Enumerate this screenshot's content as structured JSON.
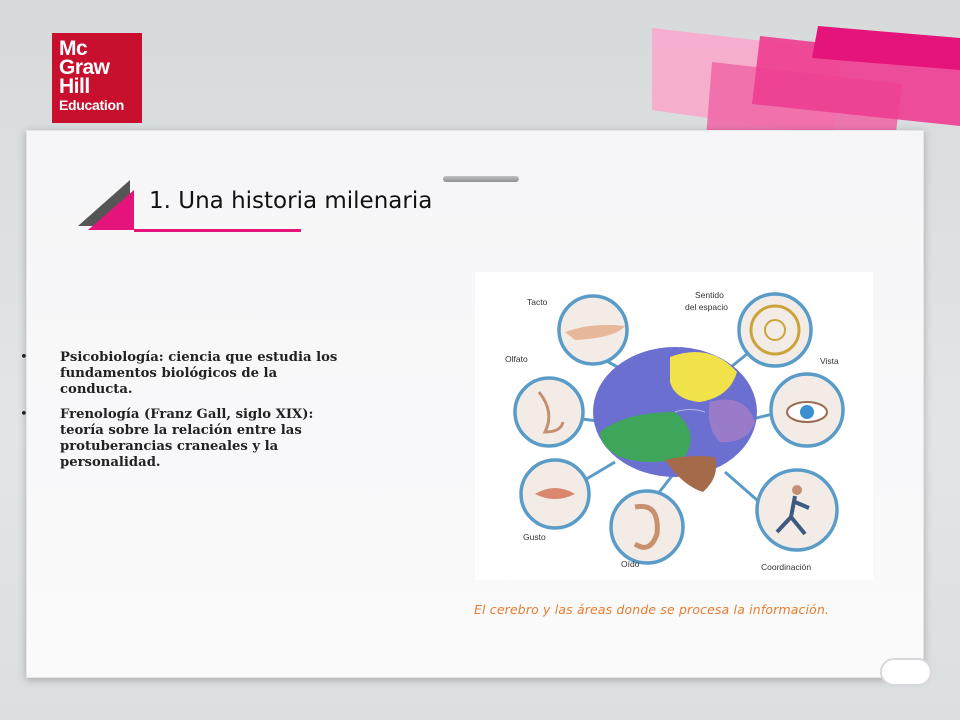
{
  "logo": {
    "line1": "Mc",
    "line2": "Graw",
    "line3": "Hill",
    "line4": "Education"
  },
  "slide": {
    "title": "1. Una historia milenaria",
    "bullets": [
      {
        "marker": "•",
        "text": "Psicobiología: ciencia que estudia los fundamentos biológicos de la conducta."
      },
      {
        "marker": "•",
        "text": "Frenología (Franz Gall, siglo XIX): teoría sobre la relación entre las protuberancias craneales y la personalidad."
      }
    ]
  },
  "figure": {
    "labels": {
      "tacto": "Tacto",
      "sentido1": "Sentido",
      "sentido2": "del espacio",
      "olfato": "Olfato",
      "vista": "Vista",
      "gusto": "Gusto",
      "oido": "Oído",
      "coordinacion": "Coordinación"
    },
    "caption": "El cerebro y las áreas donde se procesa la información."
  },
  "colors": {
    "brand_red": "#c8102e",
    "accent_pink": "#e5147a",
    "caption_orange": "#e67c2e"
  }
}
